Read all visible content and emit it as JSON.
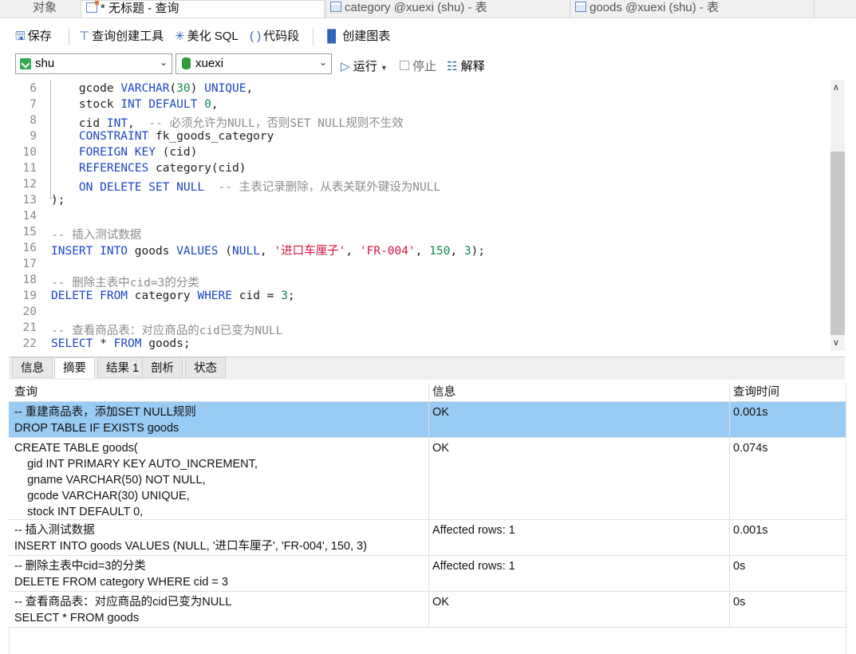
{
  "tabs": [
    {
      "label": "对象"
    },
    {
      "label": "* 无标题 - 查询"
    },
    {
      "label": "category @xuexi (shu) - 表"
    },
    {
      "label": "goods @xuexi (shu) - 表"
    }
  ],
  "toolbar": {
    "save": "保存",
    "query_builder": "查询创建工具",
    "beautify": "美化 SQL",
    "snippet": "代码段",
    "create_chart": "创建图表"
  },
  "connection": {
    "value": "shu"
  },
  "database": {
    "value": "xuexi"
  },
  "run": {
    "run": "运行",
    "stop": "停止",
    "explain": "解释"
  },
  "editor": {
    "lines": [
      {
        "n": "6"
      },
      {
        "n": "7"
      },
      {
        "n": "8"
      },
      {
        "n": "9"
      },
      {
        "n": "10"
      },
      {
        "n": "11"
      },
      {
        "n": "12"
      },
      {
        "n": "13"
      },
      {
        "n": "14"
      },
      {
        "n": "15"
      },
      {
        "n": "16"
      },
      {
        "n": "17"
      },
      {
        "n": "18"
      },
      {
        "n": "19"
      },
      {
        "n": "20"
      },
      {
        "n": "21"
      },
      {
        "n": "22"
      }
    ],
    "code": {
      "l6a": "    gcode ",
      "l6b": "VARCHAR",
      "l6c": "(",
      "l6d": "30",
      "l6e": ") ",
      "l6f": "UNIQUE",
      "l6g": ",",
      "l7a": "    stock ",
      "l7b": "INT DEFAULT ",
      "l7c": "0",
      "l7d": ",",
      "l8a": "    cid ",
      "l8b": "INT",
      "l8c": ",  ",
      "l8d": "-- 必须允许为NULL，否则SET NULL规则不生效",
      "l9a": "    ",
      "l9b": "CONSTRAINT",
      "l9c": " fk_goods_category",
      "l10a": "    ",
      "l10b": "FOREIGN KEY",
      "l10c": " (cid)",
      "l11a": "    ",
      "l11b": "REFERENCES",
      "l11c": " category(cid)",
      "l12a": "    ",
      "l12b": "ON DELETE SET NULL",
      "l12c": "  ",
      "l12d": "-- 主表记录删除，从表关联外键设为NULL",
      "l13": ");",
      "l15": "-- 插入测试数据",
      "l16a": "INSERT INTO",
      "l16b": " goods ",
      "l16c": "VALUES",
      "l16d": " (",
      "l16e": "NULL",
      "l16f": ", ",
      "l16g": "'进口车厘子'",
      "l16h": ", ",
      "l16i": "'FR-004'",
      "l16j": ", ",
      "l16k": "150",
      "l16l": ", ",
      "l16m": "3",
      "l16n": ");",
      "l18": "-- 删除主表中cid=3的分类",
      "l19a": "DELETE FROM",
      "l19b": " category ",
      "l19c": "WHERE",
      "l19d": " cid = ",
      "l19e": "3",
      "l19f": ";",
      "l21": "-- 查看商品表：对应商品的cid已变为NULL",
      "l22a": "SELECT",
      "l22b": " * ",
      "l22c": "FROM",
      "l22d": " goods;"
    }
  },
  "result_tabs": [
    "信息",
    "摘要",
    "结果 1",
    "剖析",
    "状态"
  ],
  "summary": {
    "headers": {
      "query": "查询",
      "info": "信息",
      "time": "查询时间"
    },
    "rows": [
      {
        "query": "-- 重建商品表，添加SET NULL规则\nDROP TABLE IF EXISTS goods",
        "info": "OK",
        "time": "0.001s"
      },
      {
        "query": "CREATE TABLE goods(\n    gid INT PRIMARY KEY AUTO_INCREMENT,\n    gname VARCHAR(50) NOT NULL,\n    gcode VARCHAR(30) UNIQUE,\n    stock INT DEFAULT 0,",
        "info": "OK",
        "time": "0.074s"
      },
      {
        "query": "-- 插入测试数据\nINSERT INTO goods VALUES (NULL, '进口车厘子', 'FR-004', 150, 3)",
        "info": "Affected rows: 1",
        "time": "0.001s"
      },
      {
        "query": "-- 删除主表中cid=3的分类\nDELETE FROM category WHERE cid = 3",
        "info": "Affected rows: 1",
        "time": "0s"
      },
      {
        "query": "-- 查看商品表：对应商品的cid已变为NULL\nSELECT * FROM goods",
        "info": "OK",
        "time": "0s"
      }
    ]
  }
}
